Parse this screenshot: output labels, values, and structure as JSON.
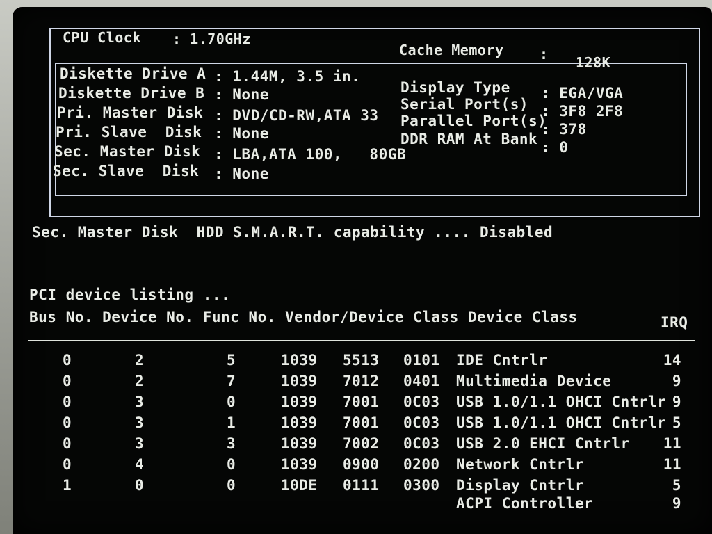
{
  "header": {
    "cpu_clock_label": "CPU Clock",
    "cpu_clock_value": ": 1.70GHz",
    "cache_label": "Cache Memory",
    "cache_colon": ":",
    "cache_value": "128K"
  },
  "drives": [
    {
      "label": "Diskette Drive A",
      "value": ": 1.44M, 3.5 in."
    },
    {
      "label": "Diskette Drive B",
      "value": ": None"
    },
    {
      "label": "Pri. Master Disk",
      "value": ": DVD/CD-RW,ATA 33"
    },
    {
      "label": "Pri. Slave  Disk",
      "value": ": None"
    },
    {
      "label": "Sec. Master Disk",
      "value": ": LBA,ATA 100,   80GB"
    },
    {
      "label": "Sec. Slave  Disk",
      "value": ": None"
    }
  ],
  "system": [
    {
      "label": "Display Type",
      "value": ": EGA/VGA"
    },
    {
      "label": "Serial Port(s)",
      "value": ": 3F8 2F8"
    },
    {
      "label": "Parallel Port(s)",
      "value": ": 378"
    },
    {
      "label": "DDR RAM At Bank",
      "value": ": 0"
    }
  ],
  "smart_line": "Sec. Master Disk  HDD S.M.A.R.T. capability .... Disabled",
  "pci": {
    "title": "PCI device listing ...",
    "headers": {
      "main": "Bus No. Device No. Func No. Vendor/Device Class Device Class",
      "irq": "IRQ"
    },
    "rows": [
      {
        "bus": "0",
        "device": "2",
        "func": "5",
        "vendor": "1039",
        "dev": "5513",
        "class": "0101",
        "name": "IDE Cntrlr",
        "irq": "14"
      },
      {
        "bus": "0",
        "device": "2",
        "func": "7",
        "vendor": "1039",
        "dev": "7012",
        "class": "0401",
        "name": "Multimedia Device",
        "irq": "9"
      },
      {
        "bus": "0",
        "device": "3",
        "func": "0",
        "vendor": "1039",
        "dev": "7001",
        "class": "0C03",
        "name": "USB 1.0/1.1 OHCI Cntrlr",
        "irq": "9"
      },
      {
        "bus": "0",
        "device": "3",
        "func": "1",
        "vendor": "1039",
        "dev": "7001",
        "class": "0C03",
        "name": "USB 1.0/1.1 OHCI Cntrlr",
        "irq": "5"
      },
      {
        "bus": "0",
        "device": "3",
        "func": "3",
        "vendor": "1039",
        "dev": "7002",
        "class": "0C03",
        "name": "USB 2.0 EHCI Cntrlr",
        "irq": "11"
      },
      {
        "bus": "0",
        "device": "4",
        "func": "0",
        "vendor": "1039",
        "dev": "0900",
        "class": "0200",
        "name": "Network Cntrlr",
        "irq": "11"
      },
      {
        "bus": "1",
        "device": "0",
        "func": "0",
        "vendor": "10DE",
        "dev": "0111",
        "class": "0300",
        "name": "Display Cntrlr",
        "irq": "5"
      },
      {
        "bus": "",
        "device": "",
        "func": "",
        "vendor": "",
        "dev": "",
        "class": "",
        "name": "ACPI Controller",
        "irq": "9"
      }
    ]
  },
  "colors": {
    "screen_bg": "#050605",
    "text": "#e9ece6",
    "frame": "#cfd6e6"
  }
}
